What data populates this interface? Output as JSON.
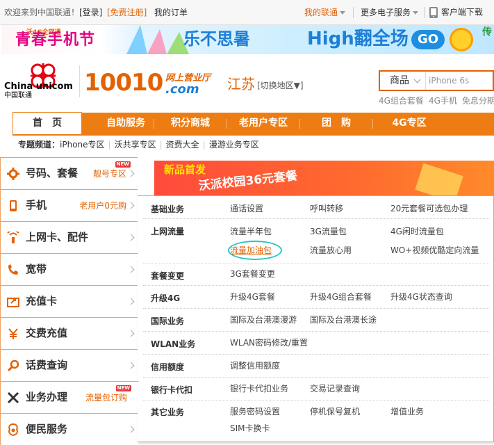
{
  "topbar": {
    "welcome": "欢迎来到中国联通！",
    "login": "[登录]",
    "register": "[免费注册]",
    "my_orders": "我的订单",
    "my_unicom": "我的联通",
    "more_services": "更多电子服务",
    "client_download": "客户端下载"
  },
  "banner": {
    "left_title": "青春手机节",
    "left_small": "沃4G全网通",
    "mid_title": "乐不思暑",
    "right_title": "High翻全场",
    "go": "GO",
    "edge_text": "传"
  },
  "brand": {
    "logo_en": "China unicom",
    "logo_cn": "中国联通",
    "number": "10010",
    "hall": "网上营业厅",
    "domain": ".com",
    "province": "江苏",
    "switch_region": "[切换地区▼]"
  },
  "search": {
    "category": "商品",
    "placeholder": "iPhone 6s",
    "hot_words": [
      "4G组合套餐",
      "4G手机",
      "免息分期"
    ]
  },
  "nav": {
    "items": [
      "首　页",
      "自助服务",
      "积分商城",
      "老用户专区",
      "团　购",
      "4G专区"
    ]
  },
  "channels": {
    "label": "专题频道：",
    "items": [
      "iPhone专区",
      "沃共享专区",
      "资费大全",
      "漫游业务专区"
    ]
  },
  "left_menu": [
    {
      "title": "号码、套餐",
      "sub": "靓号专区",
      "icon": "gear-icon",
      "badge": "NEW"
    },
    {
      "title": "手机",
      "sub": "老用户0元购",
      "icon": "phone-icon",
      "badge": ""
    },
    {
      "title": "上网卡、配件",
      "sub": "",
      "icon": "wireless-icon",
      "badge": ""
    },
    {
      "title": "宽带",
      "sub": "",
      "icon": "broadband-icon",
      "badge": ""
    },
    {
      "title": "充值卡",
      "sub": "",
      "icon": "recharge-card-icon",
      "badge": ""
    },
    {
      "title": "交费充值",
      "sub": "",
      "icon": "yen-icon",
      "badge": ""
    },
    {
      "title": "话费查询",
      "sub": "",
      "icon": "magnifier-icon",
      "badge": ""
    },
    {
      "title": "业务办理",
      "sub": "流量包订购",
      "icon": "tools-icon",
      "badge": "NEW"
    },
    {
      "title": "便民服务",
      "sub": "",
      "icon": "convenience-icon",
      "badge": ""
    }
  ],
  "promo": {
    "tag": "新品首发",
    "text": "沃派校园36元套餐"
  },
  "flyout": [
    {
      "category": "基础业务",
      "links": [
        "通话设置",
        "呼叫转移",
        "20元套餐可选包办理"
      ]
    },
    {
      "category": "上网流量",
      "links": [
        "流量半年包",
        "3G流量包",
        "4G闲时流量包",
        "流量加油包",
        "流量放心用",
        "WO+视频优酷定向流量"
      ]
    },
    {
      "category": "套餐变更",
      "links": [
        "3G套餐变更"
      ]
    },
    {
      "category": "升级4G",
      "links": [
        "升级4G套餐",
        "升级4G组合套餐",
        "升级4G状态查询"
      ]
    },
    {
      "category": "国际业务",
      "links": [
        "国际及台港澳漫游",
        "国际及台港澳长途"
      ]
    },
    {
      "category": "WLAN业务",
      "links": [
        "WLAN密码修改/重置"
      ]
    },
    {
      "category": "信用额度",
      "links": [
        "调整信用额度"
      ]
    },
    {
      "category": "银行卡代扣",
      "links": [
        "银行卡代扣业务",
        "交易记录查询"
      ]
    },
    {
      "category": "其它业务",
      "links": [
        "服务密码设置",
        "停机保号复机",
        "增值业务",
        "SIM卡换卡"
      ]
    }
  ],
  "colors": {
    "brand_orange": "#ed7d12",
    "text_orange": "#e36100",
    "highlight_ring": "#29c4c8"
  }
}
